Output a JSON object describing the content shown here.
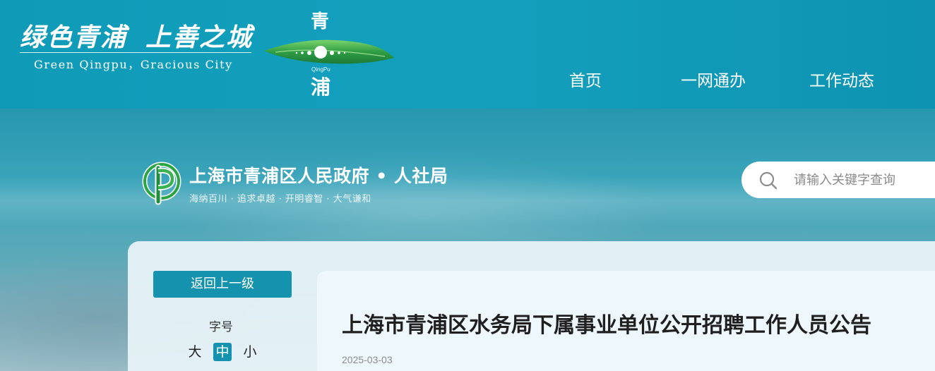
{
  "header": {
    "slogan_cn_part1": "绿色青浦",
    "slogan_cn_part2": "上善之城",
    "slogan_en": "Green Qingpu，Gracious City",
    "emblem_top": "青",
    "emblem_en": "QingPu",
    "emblem_bottom": "浦",
    "nav": [
      {
        "label": "首页"
      },
      {
        "label": "一网通办"
      },
      {
        "label": "工作动态"
      }
    ]
  },
  "department": {
    "title": "上海市青浦区人民政府 • 人社局",
    "motto": "海纳百川 · 追求卓越 · 开明睿智 · 大气谦和"
  },
  "search": {
    "placeholder": "请输入关键字查询"
  },
  "sidebar": {
    "back_label": "返回上一级",
    "font_size_label": "字号",
    "font_sizes": [
      {
        "label": "大",
        "selected": false
      },
      {
        "label": "中",
        "selected": true
      },
      {
        "label": "小",
        "selected": false
      }
    ]
  },
  "article": {
    "title": "上海市青浦区水务局下属事业单位公开招聘工作人员公告",
    "date": "2025-03-03"
  },
  "colors": {
    "header_bg": "#13a0bd",
    "accent": "#1592ae",
    "panel_bg": "#e8f3f8"
  },
  "icons": {
    "search": "search-icon",
    "dept_logo": "qingpu-hr-logo-icon",
    "emblem": "qingpu-emblem-icon"
  }
}
